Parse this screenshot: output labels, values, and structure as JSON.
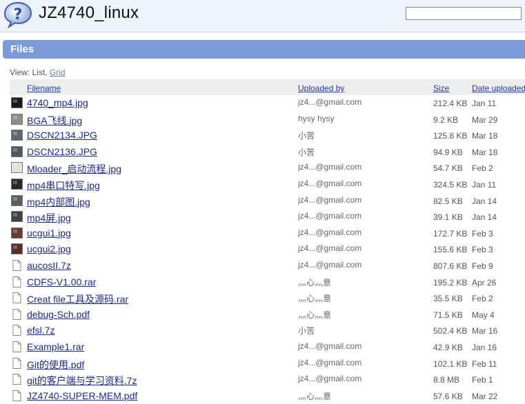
{
  "header": {
    "title": "JZ4740_linux",
    "search": {
      "value": "",
      "placeholder": ""
    }
  },
  "files_section": {
    "title": "Files",
    "view_label": "View:",
    "view_list": "List,",
    "view_grid": "Grid"
  },
  "table": {
    "columns": [
      "Filename",
      "Uploaded by",
      "Size",
      "Date uploaded"
    ],
    "rows": [
      {
        "filename": "4740_mp4.jpg",
        "uploader": "jz4...@gmail.com",
        "size": "212.4 KB",
        "date": "Jan 11",
        "icon": "image-thumbnail-icon",
        "thumb_color": "#1a1a1a"
      },
      {
        "filename": "BGA飞线.jpg",
        "uploader": "hysy hysy",
        "size": "9.2 KB",
        "date": "Mar 29",
        "icon": "image-thumbnail-icon",
        "thumb_color": "#8c8c8c"
      },
      {
        "filename": "DSCN2134.JPG",
        "uploader": "小苦",
        "size": "125.8 KB",
        "date": "Mar 18",
        "icon": "image-thumbnail-icon",
        "thumb_color": "#5c6670"
      },
      {
        "filename": "DSCN2136.JPG",
        "uploader": "小苦",
        "size": "94.9 KB",
        "date": "Mar 18",
        "icon": "image-thumbnail-icon",
        "thumb_color": "#4d5862"
      },
      {
        "filename": "Mloader_启动流程.jpg",
        "uploader": "jz4...@gmail.com",
        "size": "54.7 KB",
        "date": "Feb 2",
        "icon": "image-thumbnail-icon",
        "thumb_color": "#e6e2d8"
      },
      {
        "filename": "mp4串口特写.jpg",
        "uploader": "jz4...@gmail.com",
        "size": "324.5 KB",
        "date": "Jan 11",
        "icon": "image-thumbnail-icon",
        "thumb_color": "#2a2a2a"
      },
      {
        "filename": "mp4内部图.jpg",
        "uploader": "jz4...@gmail.com",
        "size": "82.5 KB",
        "date": "Jan 14",
        "icon": "image-thumbnail-icon",
        "thumb_color": "#56625a"
      },
      {
        "filename": "mp4屏.jpg",
        "uploader": "jz4...@gmail.com",
        "size": "39.1 KB",
        "date": "Jan 14",
        "icon": "image-thumbnail-icon",
        "thumb_color": "#3c4446"
      },
      {
        "filename": "ucgui1.jpg",
        "uploader": "jz4...@gmail.com",
        "size": "172.7 KB",
        "date": "Feb 3",
        "icon": "image-thumbnail-icon",
        "thumb_color": "#6a3a30"
      },
      {
        "filename": "ucgui2.jpg",
        "uploader": "jz4...@gmail.com",
        "size": "155.6 KB",
        "date": "Feb 3",
        "icon": "image-thumbnail-icon",
        "thumb_color": "#5a2e28"
      },
      {
        "filename": "aucosII.7z",
        "uploader": "jz4...@gmail.com",
        "size": "807.6 KB",
        "date": "Feb 9",
        "icon": "file-icon",
        "thumb_color": ""
      },
      {
        "filename": "CDFS-V1.00.rar",
        "uploader": "灬心灬意",
        "size": "195.2 KB",
        "date": "Apr 26",
        "icon": "file-icon",
        "thumb_color": ""
      },
      {
        "filename": "Creat file工具及源码.rar",
        "uploader": "灬心灬意",
        "size": "35.5 KB",
        "date": "Feb 2",
        "icon": "file-icon",
        "thumb_color": ""
      },
      {
        "filename": "debug-Sch.pdf",
        "uploader": "灬心灬意",
        "size": "71.5 KB",
        "date": "May 4",
        "icon": "file-icon",
        "thumb_color": ""
      },
      {
        "filename": "efsl.7z",
        "uploader": "小苦",
        "size": "502.4 KB",
        "date": "Mar 16",
        "icon": "file-icon",
        "thumb_color": ""
      },
      {
        "filename": "Example1.rar",
        "uploader": "jz4...@gmail.com",
        "size": "42.9 KB",
        "date": "Jan 16",
        "icon": "file-icon",
        "thumb_color": ""
      },
      {
        "filename": "Git的使用.pdf",
        "uploader": "jz4...@gmail.com",
        "size": "102.1 KB",
        "date": "Feb 11",
        "icon": "file-icon",
        "thumb_color": ""
      },
      {
        "filename": "git的客户端与学习资料.7z",
        "uploader": "jz4...@gmail.com",
        "size": "8.8 MB",
        "date": "Feb 1",
        "icon": "file-icon",
        "thumb_color": ""
      },
      {
        "filename": "JZ4740-SUPER-MEM.pdf",
        "uploader": "灬心灬意",
        "size": "57.6 KB",
        "date": "Mar 22",
        "icon": "file-icon",
        "thumb_color": ""
      }
    ]
  },
  "colors": {
    "header_bg": "#eef2fb",
    "files_bar": "#7a9ad8",
    "link": "#1a2a8c",
    "header_link": "#1e3a9c"
  }
}
